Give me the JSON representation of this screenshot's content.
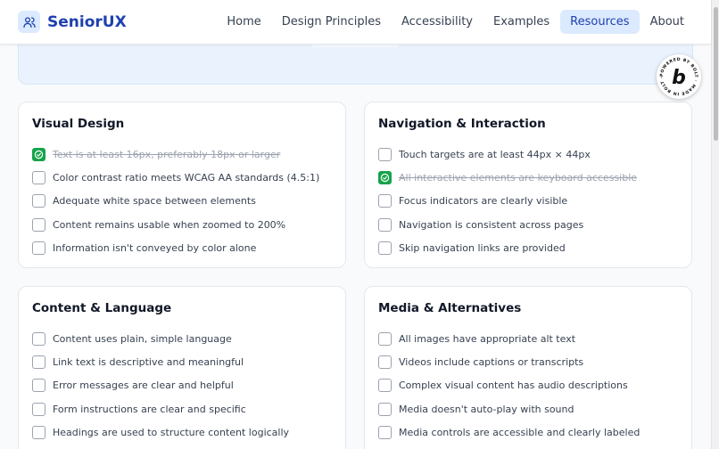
{
  "brand": {
    "name": "SeniorUX",
    "icon": "users-icon",
    "accent": "#1e40af"
  },
  "nav": [
    {
      "label": "Home",
      "active": false
    },
    {
      "label": "Design Principles",
      "active": false
    },
    {
      "label": "Accessibility",
      "active": false
    },
    {
      "label": "Examples",
      "active": false
    },
    {
      "label": "Resources",
      "active": true
    },
    {
      "label": "About",
      "active": false
    }
  ],
  "badge": {
    "icon": "bolt-logo-icon",
    "ring_text": "POWERED BY BOLT · MADE IN BOLT · NEW"
  },
  "checklist": {
    "visual_design": {
      "title": "Visual Design",
      "items": [
        {
          "label": "Text is at least 16px, preferably 18px or larger",
          "checked": true
        },
        {
          "label": "Color contrast ratio meets WCAG AA standards (4.5:1)",
          "checked": false
        },
        {
          "label": "Adequate white space between elements",
          "checked": false
        },
        {
          "label": "Content remains usable when zoomed to 200%",
          "checked": false
        },
        {
          "label": "Information isn't conveyed by color alone",
          "checked": false
        }
      ]
    },
    "navigation": {
      "title": "Navigation & Interaction",
      "items": [
        {
          "label": "Touch targets are at least 44px × 44px",
          "checked": false
        },
        {
          "label": "All interactive elements are keyboard accessible",
          "checked": true
        },
        {
          "label": "Focus indicators are clearly visible",
          "checked": false
        },
        {
          "label": "Navigation is consistent across pages",
          "checked": false
        },
        {
          "label": "Skip navigation links are provided",
          "checked": false
        }
      ]
    },
    "content": {
      "title": "Content & Language",
      "items": [
        {
          "label": "Content uses plain, simple language",
          "checked": false
        },
        {
          "label": "Link text is descriptive and meaningful",
          "checked": false
        },
        {
          "label": "Error messages are clear and helpful",
          "checked": false
        },
        {
          "label": "Form instructions are clear and specific",
          "checked": false
        },
        {
          "label": "Headings are used to structure content logically",
          "checked": false
        }
      ]
    },
    "media": {
      "title": "Media & Alternatives",
      "items": [
        {
          "label": "All images have appropriate alt text",
          "checked": false
        },
        {
          "label": "Videos include captions or transcripts",
          "checked": false
        },
        {
          "label": "Complex visual content has audio descriptions",
          "checked": false
        },
        {
          "label": "Media doesn't auto-play with sound",
          "checked": false
        },
        {
          "label": "Media controls are accessible and clearly labeled",
          "checked": false
        }
      ]
    }
  },
  "colors": {
    "checked": "#16a34a",
    "active_nav_bg": "#dbeafe",
    "hero_bg": "#eaf2fd"
  }
}
